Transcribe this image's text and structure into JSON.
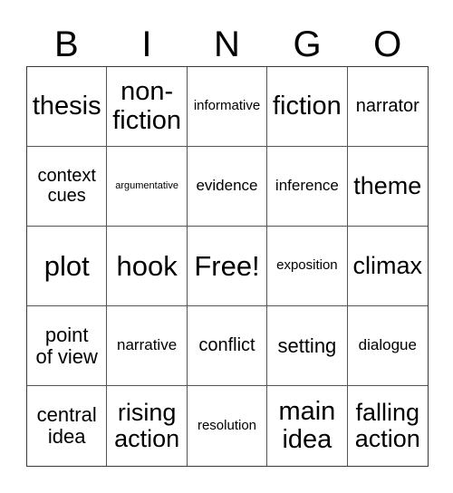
{
  "header": [
    "B",
    "I",
    "N",
    "G",
    "O"
  ],
  "cells": [
    [
      "thesis",
      "non-\nfiction",
      "informative",
      "fiction",
      "narrator"
    ],
    [
      "context\ncues",
      "argumentative",
      "evidence",
      "inference",
      "theme"
    ],
    [
      "plot",
      "hook",
      "Free!",
      "exposition",
      "climax"
    ],
    [
      "point\nof view",
      "narrative",
      "conflict",
      "setting",
      "dialogue"
    ],
    [
      "central\nidea",
      "rising\naction",
      "resolution",
      "main\nidea",
      "falling\naction"
    ]
  ]
}
